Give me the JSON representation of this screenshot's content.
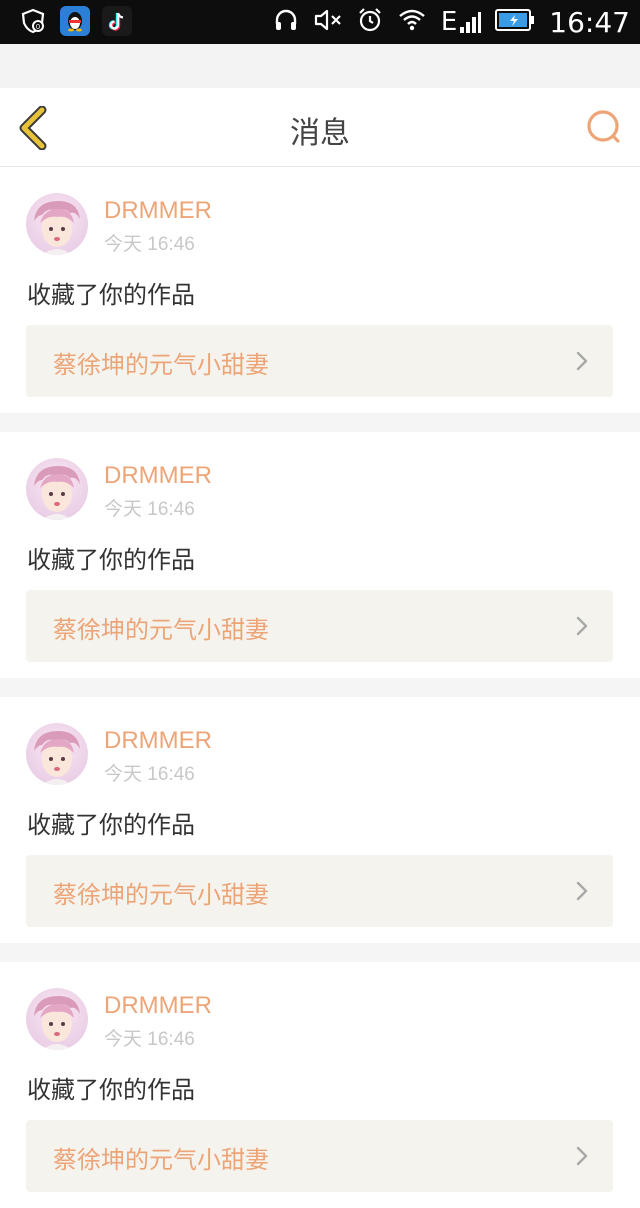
{
  "status_bar": {
    "time": "16:47",
    "network": "E",
    "left_icons": [
      "shield-badge-icon",
      "qq-penguin-icon",
      "tiktok-icon"
    ],
    "right_icons": [
      "headphones-icon",
      "mute-speaker-icon",
      "alarm-icon",
      "wifi-icon",
      "signal-icon",
      "battery-icon"
    ]
  },
  "header": {
    "title": "消息",
    "back_icon": "chevron-left-icon",
    "search_icon": "search-icon"
  },
  "colors": {
    "accent": "#eda577",
    "back_arrow": "#e8c238",
    "work_box_bg": "#f4f3ee",
    "timestamp": "#c8c8c8"
  },
  "messages": [
    {
      "username": "DRMMER",
      "time": "今天 16:46",
      "action": "收藏了你的作品",
      "work_title": "蔡徐坤的元气小甜妻"
    },
    {
      "username": "DRMMER",
      "time": "今天 16:46",
      "action": "收藏了你的作品",
      "work_title": "蔡徐坤的元气小甜妻"
    },
    {
      "username": "DRMMER",
      "time": "今天 16:46",
      "action": "收藏了你的作品",
      "work_title": "蔡徐坤的元气小甜妻"
    },
    {
      "username": "DRMMER",
      "time": "今天 16:46",
      "action": "收藏了你的作品",
      "work_title": "蔡徐坤的元气小甜妻"
    }
  ]
}
